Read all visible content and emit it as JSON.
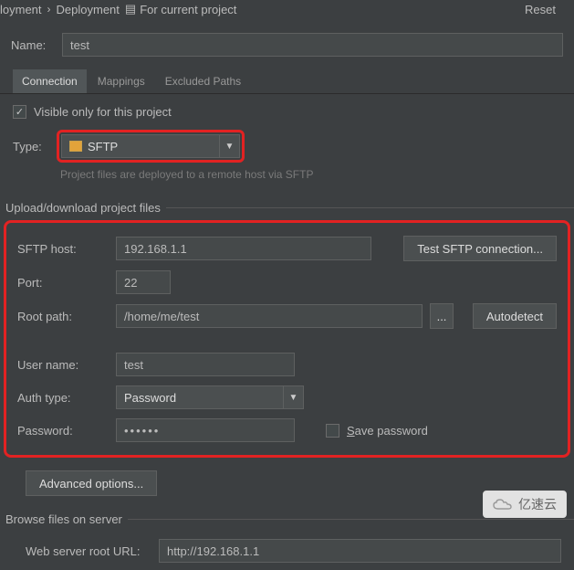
{
  "breadcrumb": {
    "seg1": "loyment",
    "seg2": "Deployment",
    "scope": "For current project"
  },
  "reset": "Reset",
  "name": {
    "label": "Name:",
    "value": "test"
  },
  "tabs": {
    "connection": "Connection",
    "mappings": "Mappings",
    "excluded": "Excluded Paths"
  },
  "visible": {
    "checked": true,
    "label": "Visible only for this project"
  },
  "type": {
    "label": "Type:",
    "value": "SFTP",
    "hint": "Project files are deployed to a remote host via SFTP"
  },
  "upload_group": "Upload/download project files",
  "fields": {
    "host_label": "SFTP host:",
    "host_value": "192.168.1.1",
    "test_btn": "Test SFTP connection...",
    "port_label": "Port:",
    "port_value": "22",
    "root_label": "Root path:",
    "root_value": "/home/me/test",
    "browse_btn": "...",
    "autodetect_btn": "Autodetect",
    "user_label": "User name:",
    "user_value": "test",
    "auth_label": "Auth type:",
    "auth_value": "Password",
    "pw_label": "Password:",
    "pw_value": "••••••",
    "save_pw": "Save password"
  },
  "advanced": "Advanced options...",
  "browse_group": "Browse files on server",
  "url": {
    "label": "Web server root URL:",
    "value": "http://192.168.1.1"
  },
  "watermark": "亿速云"
}
